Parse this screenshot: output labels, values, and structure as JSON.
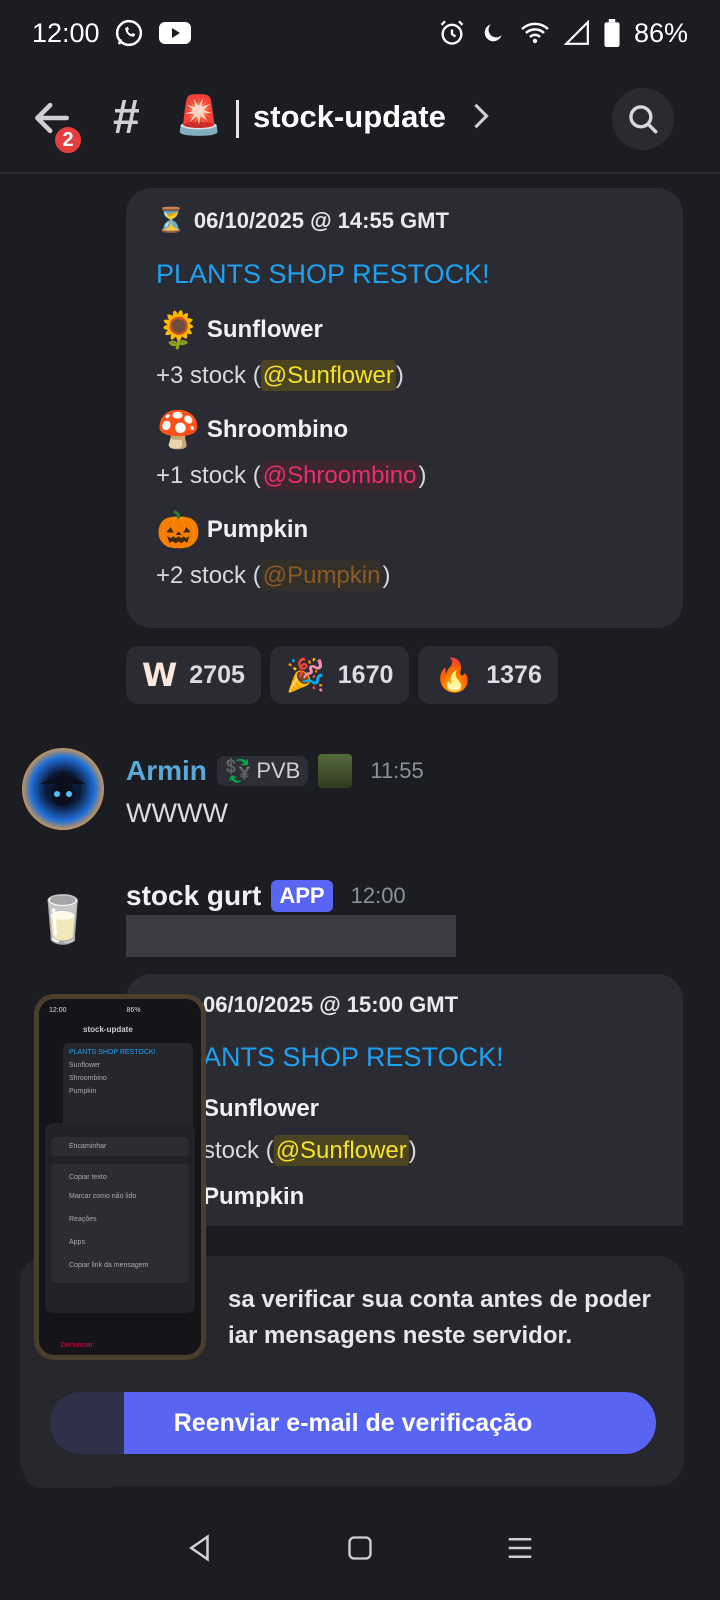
{
  "status_bar": {
    "time": "12:00",
    "battery": "86%"
  },
  "header": {
    "back_badge": "2",
    "hash": "#",
    "emoji": "🚨",
    "channel": "stock-update"
  },
  "embed1": {
    "hourglass": "⏳",
    "timestamp": "06/10/2025 @ 14:55 GMT",
    "title": "PLANTS SHOP RESTOCK!",
    "items": [
      {
        "emoji": "🌻",
        "name": "Sunflower",
        "stock_prefix": "+3 stock (",
        "mention": "@Sunflower",
        "stock_suffix": ")"
      },
      {
        "emoji": "🍄",
        "name": "Shroombino",
        "stock_prefix": "+1 stock (",
        "mention": "@Shroombino",
        "stock_suffix": ")"
      },
      {
        "emoji": "🎃",
        "name": "Pumpkin",
        "stock_prefix": "+2 stock (",
        "mention": "@Pumpkin",
        "stock_suffix": ")"
      }
    ]
  },
  "reactions": [
    {
      "emoji": "W",
      "count": "2705"
    },
    {
      "emoji": "🎉",
      "count": "1670"
    },
    {
      "emoji": "🔥",
      "count": "1376"
    }
  ],
  "message1": {
    "author": "Armin",
    "tag": "PVB",
    "tag_emoji": "💱",
    "time": "11:55",
    "text": "WWWW"
  },
  "message2": {
    "author": "stock gurt",
    "badge": "APP",
    "time": "12:00",
    "avatar_emoji": "🥛"
  },
  "embed2": {
    "timestamp": "06/10/2025 @ 15:00 GMT",
    "title_partial": "ANTS SHOP RESTOCK!",
    "item1_name": "Sunflower",
    "item1_stock_prefix": "stock (",
    "item1_mention": "@Sunflower",
    "item1_stock_suffix": ")",
    "item2_name": "Pumpkin"
  },
  "verify": {
    "line1": "sa verificar sua conta antes de poder",
    "line2": "iar mensagens neste servidor.",
    "button": "Reenviar e-mail de verificação"
  },
  "thumbnail": {
    "time": "12:00",
    "battery": "86%",
    "channel": "stock-update",
    "embed_lines": [
      "PLANTS SHOP RESTOCK!",
      "Sunflower",
      "Shroombino",
      "Pumpkin"
    ],
    "menu": [
      "Encaminhar",
      "Copiar texto",
      "Marcar como não lido",
      "Reações",
      "Apps",
      "Copiar link da mensagem"
    ],
    "bottom_label": "Denunciar"
  },
  "colors": {
    "accent": "#5865f2",
    "link": "#1ea1f1",
    "mention_yellow": "#f5e12a",
    "mention_pink": "#ea2d6f",
    "mention_brown": "#8a5b22",
    "author_teal": "#5aa9d6"
  }
}
